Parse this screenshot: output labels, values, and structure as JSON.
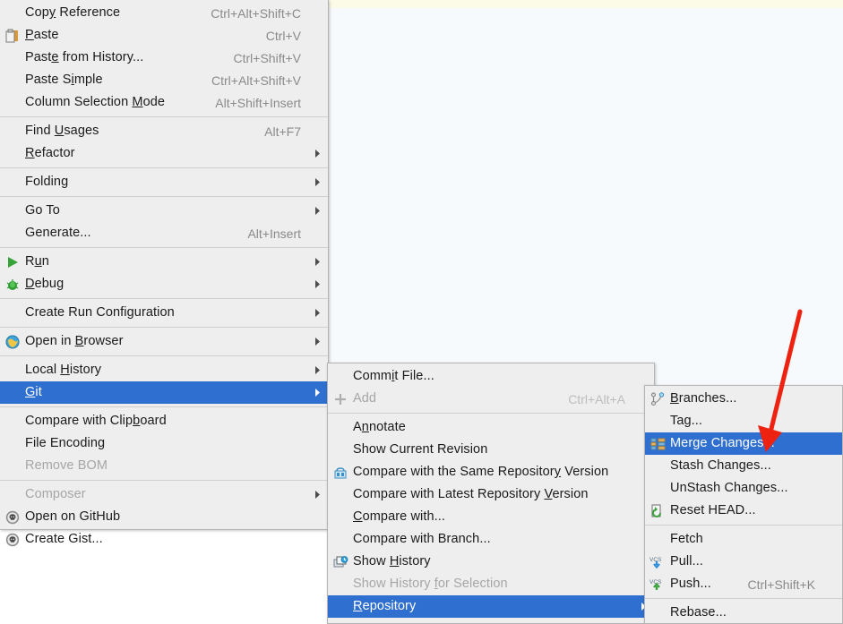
{
  "app": {
    "context": "IntelliJ IDEA editor context menu with Git submenu open",
    "accent_selected": "#2f6fd0",
    "menu_background": "#eeeeee",
    "editor_background": "#f7fafd",
    "top_strip_color": "#fcfbe8",
    "annotation_arrow_color": "#ee2211"
  },
  "menu1": {
    "name": "editor-context-menu",
    "items": [
      {
        "label": "Copy Reference",
        "accel": "Ctrl+Alt+Shift+C",
        "icon": "",
        "mnemonic": "y",
        "state": "normal",
        "submenu": false
      },
      {
        "label": "Paste",
        "accel": "Ctrl+V",
        "icon": "paste-icon",
        "mnemonic": "P",
        "state": "normal",
        "submenu": false
      },
      {
        "label": "Paste from History...",
        "accel": "Ctrl+Shift+V",
        "icon": "",
        "mnemonic": "e",
        "state": "normal",
        "submenu": false
      },
      {
        "label": "Paste Simple",
        "accel": "Ctrl+Alt+Shift+V",
        "icon": "",
        "mnemonic": "i",
        "state": "normal",
        "submenu": false
      },
      {
        "label": "Column Selection Mode",
        "accel": "Alt+Shift+Insert",
        "icon": "",
        "mnemonic": "M",
        "state": "normal",
        "submenu": false
      },
      {
        "separator": true
      },
      {
        "label": "Find Usages",
        "accel": "Alt+F7",
        "icon": "",
        "mnemonic": "U",
        "state": "normal",
        "submenu": false
      },
      {
        "label": "Refactor",
        "accel": "",
        "icon": "",
        "mnemonic": "R",
        "state": "normal",
        "submenu": true
      },
      {
        "separator": true
      },
      {
        "label": "Folding",
        "accel": "",
        "icon": "",
        "state": "normal",
        "submenu": true
      },
      {
        "separator": true
      },
      {
        "label": "Go To",
        "accel": "",
        "icon": "",
        "state": "normal",
        "submenu": true
      },
      {
        "label": "Generate...",
        "accel": "Alt+Insert",
        "icon": "",
        "state": "normal",
        "submenu": false
      },
      {
        "separator": true
      },
      {
        "label": "Run",
        "accel": "",
        "icon": "run-icon",
        "mnemonic": "u",
        "state": "normal",
        "submenu": true
      },
      {
        "label": "Debug",
        "accel": "",
        "icon": "debug-icon",
        "mnemonic": "D",
        "state": "normal",
        "submenu": true
      },
      {
        "separator": true
      },
      {
        "label": "Create Run Configuration",
        "accel": "",
        "icon": "",
        "state": "normal",
        "submenu": true
      },
      {
        "separator": true
      },
      {
        "label": "Open in Browser",
        "accel": "",
        "icon": "browser-icon",
        "mnemonic": "B",
        "state": "normal",
        "submenu": true
      },
      {
        "separator": true
      },
      {
        "label": "Local History",
        "accel": "",
        "icon": "",
        "mnemonic": "H",
        "state": "normal",
        "submenu": true
      },
      {
        "label": "Git",
        "accel": "",
        "icon": "",
        "mnemonic": "G",
        "state": "selected",
        "submenu": true
      },
      {
        "separator": true
      },
      {
        "label": "Compare with Clipboard",
        "accel": "",
        "icon": "",
        "mnemonic": "b",
        "state": "normal",
        "submenu": false
      },
      {
        "label": "File Encoding",
        "accel": "",
        "icon": "",
        "state": "normal",
        "submenu": false
      },
      {
        "label": "Remove BOM",
        "accel": "",
        "icon": "",
        "state": "disabled",
        "submenu": false
      },
      {
        "separator": true
      },
      {
        "label": "Composer",
        "accel": "",
        "icon": "",
        "state": "disabled",
        "submenu": true
      },
      {
        "label": "Open on GitHub",
        "accel": "",
        "icon": "github-icon",
        "state": "normal",
        "submenu": false
      },
      {
        "label": "Create Gist...",
        "accel": "",
        "icon": "github-icon",
        "state": "normal",
        "submenu": false
      }
    ]
  },
  "menu2": {
    "name": "git-submenu",
    "items": [
      {
        "label": "Commit File...",
        "accel": "",
        "icon": "",
        "mnemonic": "i",
        "state": "normal",
        "submenu": false
      },
      {
        "label": "Add",
        "accel": "Ctrl+Alt+A",
        "icon": "add-icon",
        "state": "disabled",
        "submenu": false
      },
      {
        "separator": true
      },
      {
        "label": "Annotate",
        "accel": "",
        "icon": "",
        "mnemonic": "n",
        "state": "normal",
        "submenu": false
      },
      {
        "label": "Show Current Revision",
        "accel": "",
        "icon": "",
        "state": "normal",
        "submenu": false
      },
      {
        "label": "Compare with the Same Repository Version",
        "accel": "",
        "icon": "compare-repo-icon",
        "mnemonic": "y",
        "state": "normal",
        "submenu": false
      },
      {
        "label": "Compare with Latest Repository Version",
        "accel": "",
        "icon": "",
        "mnemonic": "V",
        "state": "normal",
        "submenu": false
      },
      {
        "label": "Compare with...",
        "accel": "",
        "icon": "",
        "mnemonic": "C",
        "state": "normal",
        "submenu": false
      },
      {
        "label": "Compare with Branch...",
        "accel": "",
        "icon": "",
        "state": "normal",
        "submenu": false
      },
      {
        "label": "Show History",
        "accel": "",
        "icon": "history-icon",
        "mnemonic": "H",
        "state": "normal",
        "submenu": false
      },
      {
        "label": "Show History for Selection",
        "accel": "",
        "icon": "",
        "mnemonic": "f",
        "state": "disabled",
        "submenu": false
      },
      {
        "label": "Repository",
        "accel": "",
        "icon": "",
        "mnemonic": "R",
        "state": "selected",
        "submenu": true
      }
    ]
  },
  "menu3": {
    "name": "repository-submenu",
    "items": [
      {
        "label": "Branches...",
        "accel": "",
        "icon": "branches-icon",
        "mnemonic": "B",
        "state": "normal",
        "submenu": false
      },
      {
        "label": "Tag...",
        "accel": "",
        "icon": "",
        "state": "normal",
        "submenu": false
      },
      {
        "label": "Merge Changes...",
        "accel": "",
        "icon": "merge-icon",
        "state": "selected",
        "submenu": false
      },
      {
        "label": "Stash Changes...",
        "accel": "",
        "icon": "",
        "state": "normal",
        "submenu": false
      },
      {
        "label": "UnStash Changes...",
        "accel": "",
        "icon": "",
        "state": "normal",
        "submenu": false
      },
      {
        "label": "Reset HEAD...",
        "accel": "",
        "icon": "reset-head-icon",
        "state": "normal",
        "submenu": false
      },
      {
        "separator": true
      },
      {
        "label": "Fetch",
        "accel": "",
        "icon": "",
        "state": "normal",
        "submenu": false
      },
      {
        "label": "Pull...",
        "accel": "",
        "icon": "vcs-pull-icon",
        "state": "normal",
        "submenu": false
      },
      {
        "label": "Push...",
        "accel": "Ctrl+Shift+K",
        "icon": "vcs-push-icon",
        "state": "normal",
        "submenu": false
      },
      {
        "separator": true
      },
      {
        "label": "Rebase...",
        "accel": "",
        "icon": "",
        "state": "normal",
        "submenu": false
      }
    ]
  }
}
